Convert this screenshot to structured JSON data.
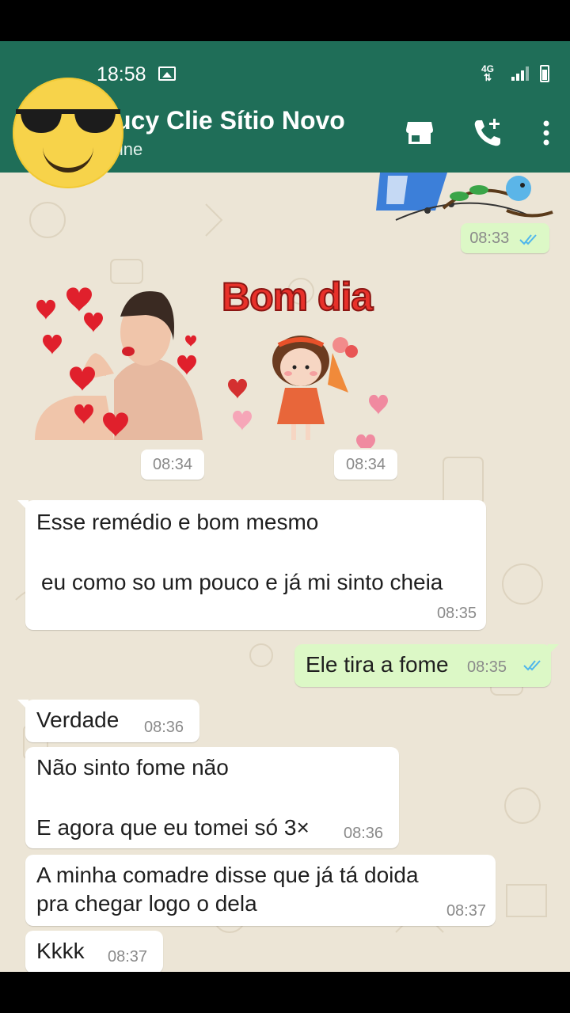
{
  "status_bar": {
    "time": "18:58",
    "network": "4G"
  },
  "header": {
    "contact_name": "ucy Clie Sítio Novo",
    "subtitle": "line",
    "accent": "#1f6e58"
  },
  "stickers": {
    "bom_dia_text": "Bom dia"
  },
  "messages": [
    {
      "id": "m1",
      "dir": "out",
      "time": "08:33",
      "read": true
    },
    {
      "id": "m2",
      "dir": "in",
      "time": "08:34",
      "kind": "sticker"
    },
    {
      "id": "m3",
      "dir": "in",
      "time": "08:34",
      "kind": "sticker"
    },
    {
      "id": "m4",
      "dir": "in",
      "lines": [
        "Esse remédio e bom mesmo",
        "eu como so um pouco e já mi sinto cheia"
      ],
      "time": "08:35"
    },
    {
      "id": "m5",
      "dir": "out",
      "lines": [
        "Ele tira a fome"
      ],
      "time": "08:35",
      "read": true
    },
    {
      "id": "m6",
      "dir": "in",
      "lines": [
        "Verdade"
      ],
      "time": "08:36"
    },
    {
      "id": "m7",
      "dir": "in",
      "lines": [
        "Não sinto fome não",
        "E agora que eu tomei só 3×"
      ],
      "time": "08:36"
    },
    {
      "id": "m8",
      "dir": "in",
      "lines": [
        "A minha comadre disse que já tá doida",
        "pra chegar logo o dela"
      ],
      "time": "08:37"
    },
    {
      "id": "m9",
      "dir": "in",
      "lines": [
        "Kkkk"
      ],
      "time": "08:37"
    }
  ],
  "colors": {
    "incoming": "#ffffff",
    "outgoing": "#dcf8c6",
    "wallpaper": "#ece5d6",
    "read_ticks": "#4fb6ec"
  }
}
